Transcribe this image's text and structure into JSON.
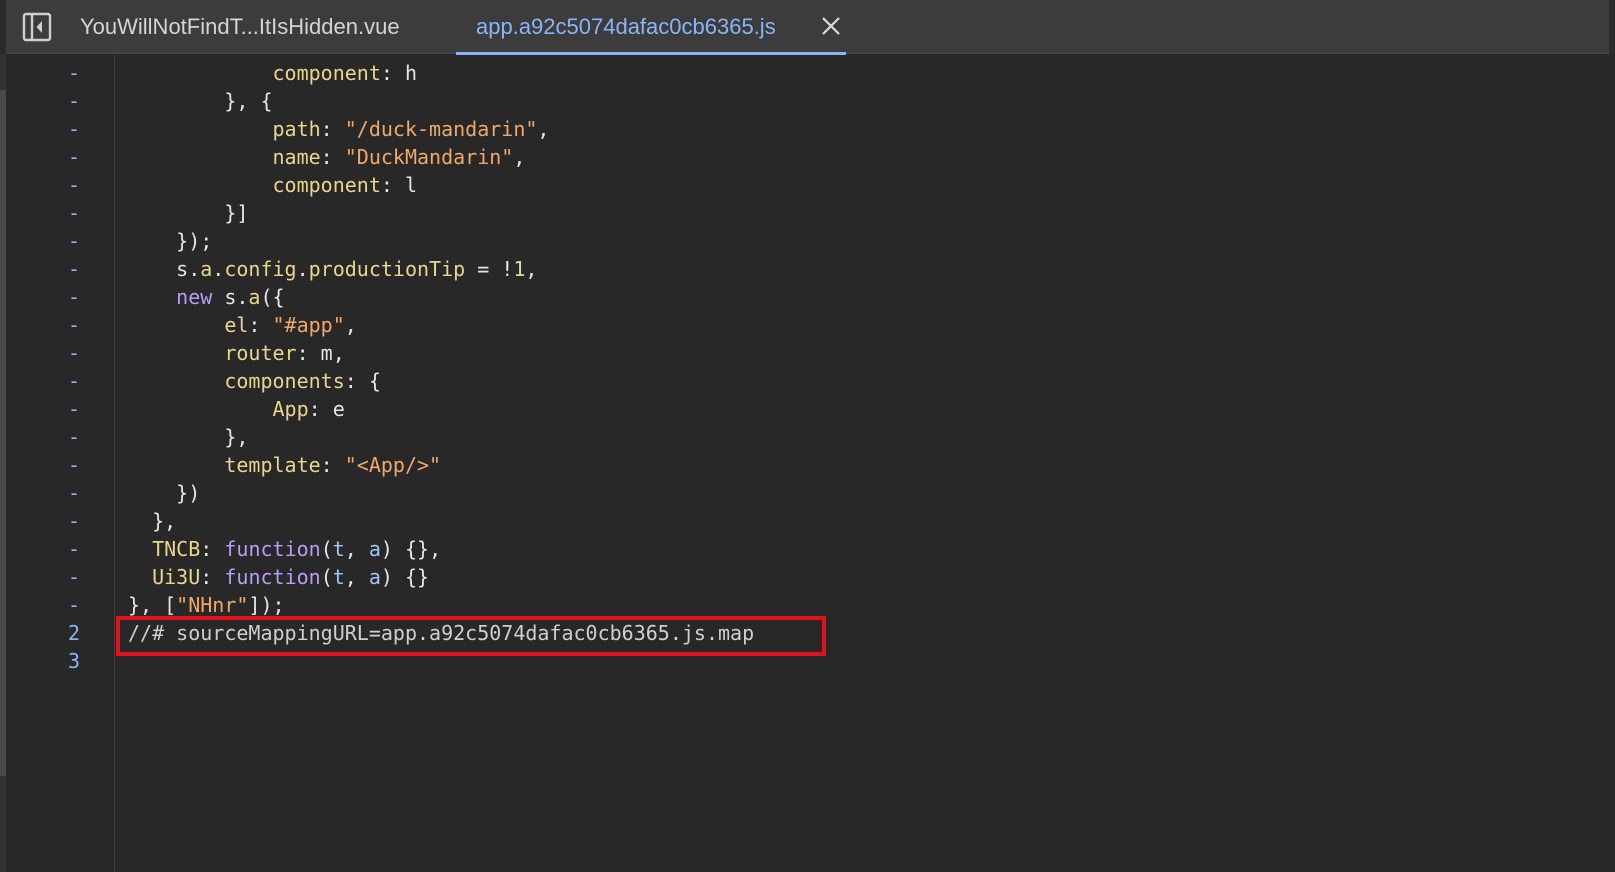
{
  "tabs": [
    {
      "label": "YouWillNotFindT...ItIsHidden.vue",
      "active": false
    },
    {
      "label": "app.a92c5074dafac0cb6365.js",
      "active": true
    }
  ],
  "colors": {
    "accent": "#8ab4f8",
    "highlight": "#e0131f",
    "background": "#282828"
  },
  "icons": {
    "sidebar_toggle": "sidebar-toggle-icon",
    "close": "close-icon"
  },
  "lines": [
    {
      "num": "-",
      "tokens": [
        {
          "t": "            ",
          "c": "p"
        },
        {
          "t": "component",
          "c": "k"
        },
        {
          "t": ": h",
          "c": "p"
        }
      ]
    },
    {
      "num": "-",
      "tokens": [
        {
          "t": "        }, {",
          "c": "p"
        }
      ]
    },
    {
      "num": "-",
      "tokens": [
        {
          "t": "            ",
          "c": "p"
        },
        {
          "t": "path",
          "c": "k"
        },
        {
          "t": ": ",
          "c": "p"
        },
        {
          "t": "\"/duck-mandarin\"",
          "c": "s"
        },
        {
          "t": ",",
          "c": "p"
        }
      ]
    },
    {
      "num": "-",
      "tokens": [
        {
          "t": "            ",
          "c": "p"
        },
        {
          "t": "name",
          "c": "k"
        },
        {
          "t": ": ",
          "c": "p"
        },
        {
          "t": "\"DuckMandarin\"",
          "c": "s"
        },
        {
          "t": ",",
          "c": "p"
        }
      ]
    },
    {
      "num": "-",
      "tokens": [
        {
          "t": "            ",
          "c": "p"
        },
        {
          "t": "component",
          "c": "k"
        },
        {
          "t": ": l",
          "c": "p"
        }
      ]
    },
    {
      "num": "-",
      "tokens": [
        {
          "t": "        }]",
          "c": "p"
        }
      ]
    },
    {
      "num": "-",
      "tokens": [
        {
          "t": "    });",
          "c": "p"
        }
      ]
    },
    {
      "num": "-",
      "tokens": [
        {
          "t": "    s.",
          "c": "p"
        },
        {
          "t": "a",
          "c": "k"
        },
        {
          "t": ".",
          "c": "p"
        },
        {
          "t": "config",
          "c": "k"
        },
        {
          "t": ".",
          "c": "p"
        },
        {
          "t": "productionTip",
          "c": "k"
        },
        {
          "t": " = !",
          "c": "p"
        },
        {
          "t": "1",
          "c": "n"
        },
        {
          "t": ",",
          "c": "p"
        }
      ]
    },
    {
      "num": "-",
      "tokens": [
        {
          "t": "    ",
          "c": "p"
        },
        {
          "t": "new",
          "c": "kw"
        },
        {
          "t": " s.",
          "c": "p"
        },
        {
          "t": "a",
          "c": "k"
        },
        {
          "t": "({",
          "c": "p"
        }
      ]
    },
    {
      "num": "-",
      "tokens": [
        {
          "t": "        ",
          "c": "p"
        },
        {
          "t": "el",
          "c": "k"
        },
        {
          "t": ": ",
          "c": "p"
        },
        {
          "t": "\"#app\"",
          "c": "s"
        },
        {
          "t": ",",
          "c": "p"
        }
      ]
    },
    {
      "num": "-",
      "tokens": [
        {
          "t": "        ",
          "c": "p"
        },
        {
          "t": "router",
          "c": "k"
        },
        {
          "t": ": m,",
          "c": "p"
        }
      ]
    },
    {
      "num": "-",
      "tokens": [
        {
          "t": "        ",
          "c": "p"
        },
        {
          "t": "components",
          "c": "k"
        },
        {
          "t": ": {",
          "c": "p"
        }
      ]
    },
    {
      "num": "-",
      "tokens": [
        {
          "t": "            ",
          "c": "p"
        },
        {
          "t": "App",
          "c": "k"
        },
        {
          "t": ": e",
          "c": "p"
        }
      ]
    },
    {
      "num": "-",
      "tokens": [
        {
          "t": "        },",
          "c": "p"
        }
      ]
    },
    {
      "num": "-",
      "tokens": [
        {
          "t": "        ",
          "c": "p"
        },
        {
          "t": "template",
          "c": "k"
        },
        {
          "t": ": ",
          "c": "p"
        },
        {
          "t": "\"<App/>\"",
          "c": "s"
        }
      ]
    },
    {
      "num": "-",
      "tokens": [
        {
          "t": "    })",
          "c": "p"
        }
      ]
    },
    {
      "num": "-",
      "tokens": [
        {
          "t": "  },",
          "c": "p"
        }
      ]
    },
    {
      "num": "-",
      "tokens": [
        {
          "t": "  ",
          "c": "p"
        },
        {
          "t": "TNCB",
          "c": "k"
        },
        {
          "t": ": ",
          "c": "p"
        },
        {
          "t": "function",
          "c": "kw"
        },
        {
          "t": "(",
          "c": "p"
        },
        {
          "t": "t",
          "c": "pr"
        },
        {
          "t": ", ",
          "c": "p"
        },
        {
          "t": "a",
          "c": "pr"
        },
        {
          "t": ") {},",
          "c": "p"
        }
      ]
    },
    {
      "num": "-",
      "tokens": [
        {
          "t": "  ",
          "c": "p"
        },
        {
          "t": "Ui3U",
          "c": "k"
        },
        {
          "t": ": ",
          "c": "p"
        },
        {
          "t": "function",
          "c": "kw"
        },
        {
          "t": "(",
          "c": "p"
        },
        {
          "t": "t",
          "c": "pr"
        },
        {
          "t": ", ",
          "c": "p"
        },
        {
          "t": "a",
          "c": "pr"
        },
        {
          "t": ") {}",
          "c": "p"
        }
      ]
    },
    {
      "num": "-",
      "tokens": [
        {
          "t": "}, [",
          "c": "p"
        },
        {
          "t": "\"NHnr\"",
          "c": "s"
        },
        {
          "t": "]);",
          "c": "p"
        }
      ]
    },
    {
      "num": "2",
      "tokens": [
        {
          "t": "//# sourceMappingURL=app.a92c5074dafac0cb6365.js.map",
          "c": "c"
        }
      ]
    },
    {
      "num": "3",
      "tokens": []
    }
  ]
}
